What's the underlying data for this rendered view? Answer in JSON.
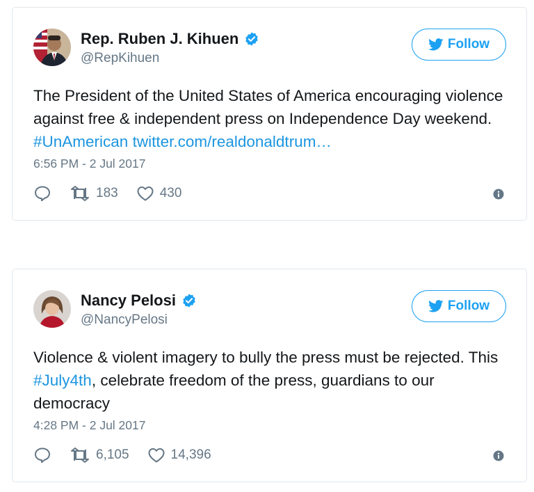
{
  "colors": {
    "link": "#1b95e0",
    "accent": "#1da1f2",
    "muted": "#657786",
    "border": "#e1e8ed"
  },
  "tweets": [
    {
      "display_name": "Rep. Ruben J. Kihuen",
      "handle": "@RepKihuen",
      "follow_label": "Follow",
      "text_before": "The President of the United States of America encouraging violence against free & independent press on Independence Day weekend. ",
      "hashtag": "#UnAmerican",
      "text_between": " ",
      "link": "twitter.com/realdonaldtrum…",
      "text_after": "",
      "timestamp": "6:56 PM - 2 Jul 2017",
      "retweets": "183",
      "likes": "430"
    },
    {
      "display_name": "Nancy Pelosi",
      "handle": "@NancyPelosi",
      "follow_label": "Follow",
      "text_before": "Violence & violent imagery to bully the press must be rejected. This ",
      "hashtag": "#July4th",
      "text_between": ", celebrate freedom of the press, guardians to our democracy",
      "link": "",
      "text_after": "",
      "timestamp": "4:28 PM - 2 Jul 2017",
      "retweets": "6,105",
      "likes": "14,396"
    }
  ]
}
